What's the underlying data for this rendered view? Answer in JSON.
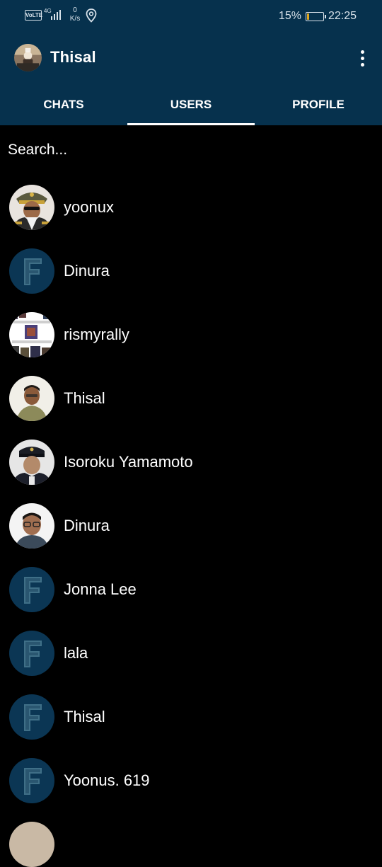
{
  "status_bar": {
    "volte": "VoLTE",
    "network": "4G",
    "speed_value": "0",
    "speed_unit": "K/s",
    "battery_percent": "15%",
    "battery_level": 0.15,
    "time": "22:25"
  },
  "toolbar": {
    "title": "Thisal",
    "menu_icon": "more-vert-icon"
  },
  "tabs": [
    {
      "label": "CHATS",
      "active": false
    },
    {
      "label": "USERS",
      "active": true
    },
    {
      "label": "PROFILE",
      "active": false
    }
  ],
  "search": {
    "placeholder": "Search..."
  },
  "users": [
    {
      "name": "yoonux",
      "avatar": "photo-officer"
    },
    {
      "name": "Dinura",
      "avatar": "default-f"
    },
    {
      "name": "rismyrally",
      "avatar": "photo-collage"
    },
    {
      "name": "Thisal",
      "avatar": "photo-selfie"
    },
    {
      "name": "Isoroku Yamamoto",
      "avatar": "photo-admiral"
    },
    {
      "name": "Dinura",
      "avatar": "photo-glasses"
    },
    {
      "name": "Jonna Lee",
      "avatar": "default-f"
    },
    {
      "name": "lala",
      "avatar": "default-f"
    },
    {
      "name": "Thisal",
      "avatar": "default-f"
    },
    {
      "name": "Yoonus. 619",
      "avatar": "default-f"
    }
  ],
  "colors": {
    "app_bar": "#06314d",
    "background": "#000000",
    "text": "#ffffff",
    "default_avatar_bg": "#0b3654",
    "default_avatar_letter": "#3f6f87"
  }
}
